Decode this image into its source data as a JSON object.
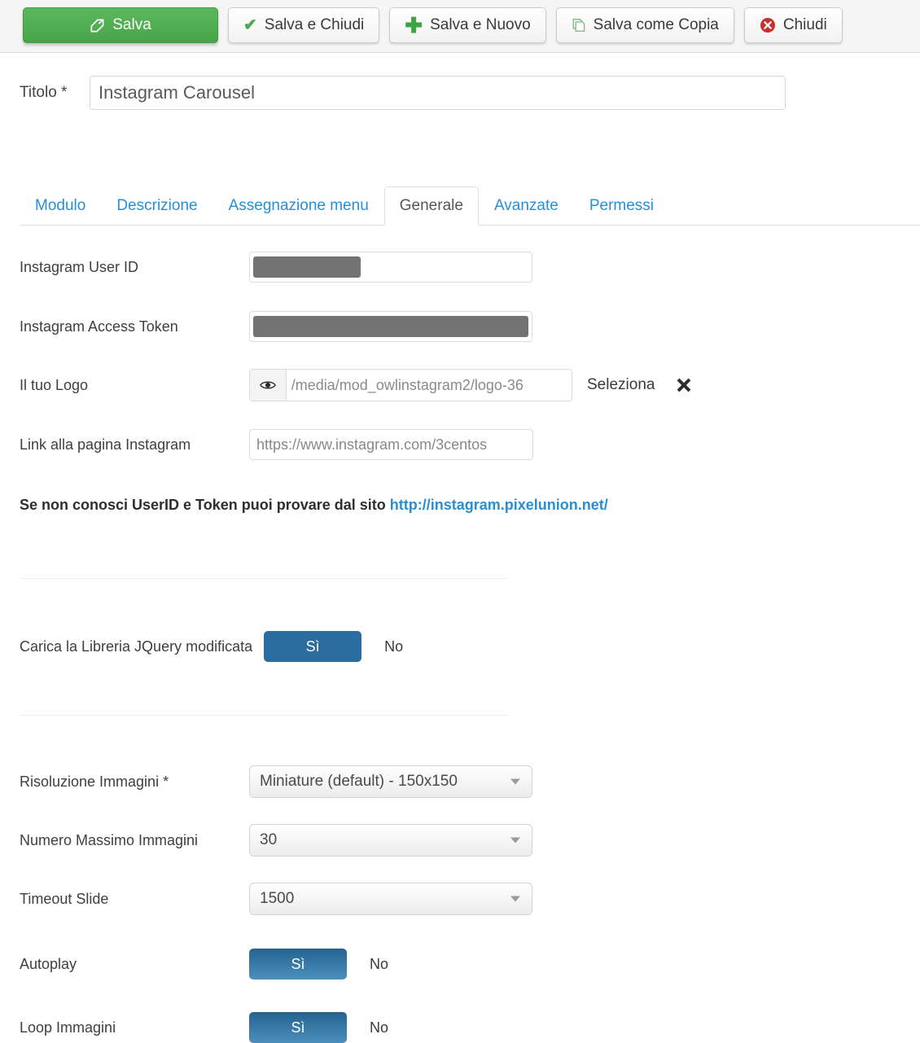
{
  "toolbar": {
    "buttons": [
      {
        "label": "Salva",
        "icon": "edit-icon",
        "style": "primary"
      },
      {
        "label": "Salva e Chiudi",
        "icon": "check-icon",
        "style": "default"
      },
      {
        "label": "Salva e Nuovo",
        "icon": "plus-icon",
        "style": "default"
      },
      {
        "label": "Salva come Copia",
        "icon": "copy-icon",
        "style": "default"
      },
      {
        "label": "Chiudi",
        "icon": "close-circle-icon",
        "style": "default"
      }
    ]
  },
  "title": {
    "label": "Titolo *",
    "value": "Instagram Carousel"
  },
  "tabs": [
    {
      "label": "Modulo",
      "active": false
    },
    {
      "label": "Descrizione",
      "active": false
    },
    {
      "label": "Assegnazione menu",
      "active": false
    },
    {
      "label": "Generale",
      "active": true
    },
    {
      "label": "Avanzate",
      "active": false
    },
    {
      "label": "Permessi",
      "active": false
    }
  ],
  "fields": {
    "user_id": {
      "label": "Instagram User ID",
      "value": "",
      "redacted": true
    },
    "access_token": {
      "label": "Instagram Access Token",
      "value": "",
      "redacted": true
    },
    "logo": {
      "label": "Il tuo Logo",
      "value": "/media/mod_owlinstagram2/logo-36",
      "select_label": "Seleziona",
      "preview_icon": "eye-icon",
      "clear_icon": "close-x-icon"
    },
    "page_link": {
      "label": "Link alla pagina Instagram",
      "value": "https://www.instagram.com/3centos"
    }
  },
  "note": {
    "text": "Se non conosci UserID e Token puoi provare dal sito ",
    "link_text": "http://instagram.pixelunion.net/"
  },
  "jquery": {
    "label": "Carica la Libreria JQuery modificata",
    "yes": "Sì",
    "no": "No",
    "selected": "yes"
  },
  "selects": {
    "resolution": {
      "label": "Risoluzione Immagini *",
      "value": "Miniature (default) - 150x150"
    },
    "max_images": {
      "label": "Numero Massimo Immagini",
      "value": "30"
    },
    "slide_timeout": {
      "label": "Timeout Slide",
      "value": "1500"
    }
  },
  "autoplay": {
    "label": "Autoplay",
    "yes": "Sì",
    "no": "No",
    "selected": "yes"
  },
  "loop": {
    "label": "Loop Immagini",
    "yes": "Sì",
    "no": "No",
    "selected": "yes"
  },
  "colors": {
    "primary_green": "#4eab4e",
    "accent_blue": "#2a8fd0",
    "toggle_blue": "#2b6d9e",
    "close_red": "#c9302c"
  }
}
